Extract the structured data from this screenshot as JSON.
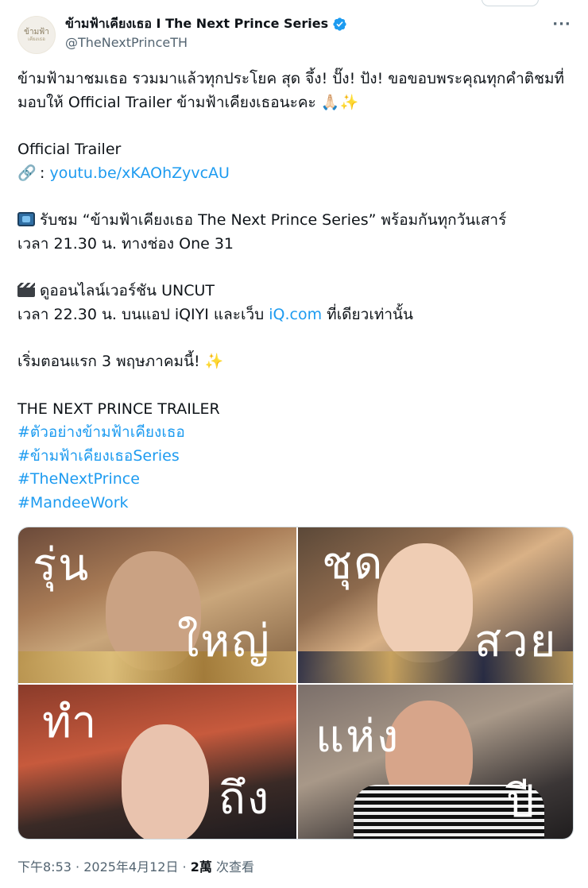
{
  "tweet": {
    "display_name": "ข้ามฟ้าเคียงเธอ I The Next Prince Series",
    "handle": "@TheNextPrinceTH",
    "avatar_text_line1": "ข้ามฟ้า",
    "avatar_text_line2": "เคียงเธอ",
    "lines": {
      "l1": "ข้ามฟ้ามาชมเธอ รวมมาแล้วทุกประโยค สุด จึ้ง! ปั๊ง! ปัง! ขอขอบพระคุณทุกคำติชมที่",
      "l2": "มอบให้ Official Trailer ข้ามฟ้าเคียงเธอนะคะ 🙏🏻✨",
      "l3": "Official Trailer",
      "l4_prefix": " : ",
      "l4_link": "youtu.be/xKAOhZyvcAU",
      "l5": " รับชม “ข้ามฟ้าเคียงเธอ The Next Prince Series” พร้อมกันทุกวันเสาร์",
      "l6": "เวลา 21.30 น. ทางช่อง One 31",
      "l7": " ดูออนไลน์เวอร์ชัน UNCUT",
      "l8_prefix": "เวลา 22.30 น. บนแอป iQIYI และเว็บ ",
      "l8_link": "iQ.com",
      "l8_suffix": " ที่เดียวเท่านั้น",
      "l9": "เริ่มตอนแรก 3 พฤษภาคมนี้! ✨",
      "l10": "THE NEXT PRINCE TRAILER"
    },
    "hashtags": [
      "#ตัวอย่างข้ามฟ้าเคียงเธอ",
      "#ข้ามฟ้าเคียงเธอSeries",
      "#TheNextPrince",
      "#MandeeWork"
    ],
    "media_overlays": [
      "รุ่น",
      "ใหญ่",
      "ชุด",
      "สวย",
      "ทำ",
      "ถึง",
      "แห่ง",
      "ปี"
    ],
    "footer": {
      "time": "下午8:53",
      "sep": " · ",
      "date": "2025年4月12日",
      "views_count": "2萬",
      "views_label": " 次查看"
    }
  },
  "colors": {
    "link": "#1d9bf0",
    "text": "#0f1419",
    "muted": "#536471",
    "verified": "#1d9bf0"
  },
  "icons": {
    "verified": "verified-badge-icon",
    "more": "more-horizontal-icon",
    "link": "link-icon",
    "tv": "tv-icon",
    "clapper": "clapper-board-icon"
  }
}
